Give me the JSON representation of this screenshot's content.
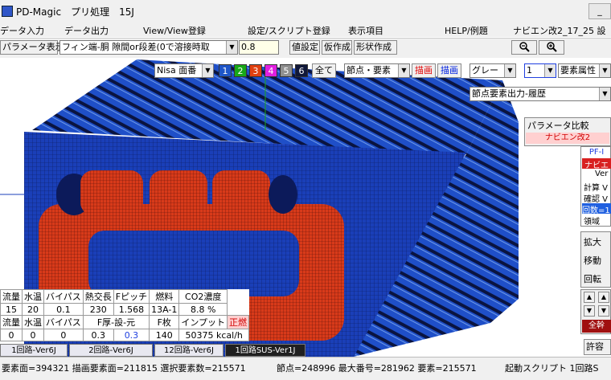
{
  "window": {
    "title": "PD-Magic　プリ処理　15J",
    "minimize_label": "_"
  },
  "menu": [
    {
      "label": "データ入力"
    },
    {
      "label": "データ出力"
    },
    {
      "label": "View/View登録"
    },
    {
      "label": "設定/スクリプト登録"
    },
    {
      "label": "表示項目"
    },
    {
      "label": "HELP/例題"
    },
    {
      "label": "ナビエン改2_17_25 設"
    }
  ],
  "toolbar": {
    "param_button": "パラメータ表示",
    "param_select": "フィン端-胴 隙間or段差(0で溶接時取",
    "param_value": "0.8",
    "set_value": "値設定",
    "temp_create": "仮作成",
    "shape_create": "形状作成",
    "zoom_out_icon": "zoom-out-icon",
    "zoom_in_icon": "zoom-in-icon"
  },
  "viewbar": {
    "nisa_select": "Nisa 面番",
    "layers": [
      {
        "label": "1",
        "color": "#1f56c8"
      },
      {
        "label": "2",
        "color": "#18a818"
      },
      {
        "label": "3",
        "color": "#e04010"
      },
      {
        "label": "4",
        "color": "#e020e0"
      },
      {
        "label": "5",
        "color": "#909090"
      },
      {
        "label": "6",
        "color": "#10183a"
      }
    ],
    "all_button": "全て",
    "node_select": "節点・要素",
    "draw_red": "描画",
    "draw_blue": "描画",
    "color_select": "グレー",
    "num_select": "1",
    "attr_select": "要素属性",
    "output_select": "節点要素出力-履歴"
  },
  "side": {
    "param_compare": "パラメータ比較",
    "navien_pink": "ナビエン改2",
    "pf_label": "PF-I",
    "navien2": "ナビエン",
    "ver": "Ver",
    "calc": "計算 V",
    "check": "確認 V",
    "count": "回数=1",
    "region": "領域",
    "expand": "拡大",
    "move": "移動",
    "rotate": "回転",
    "permit": "許容",
    "zenkan": "全幹"
  },
  "table": {
    "header1": [
      "流量",
      "水温",
      "バイパス",
      "熱交長",
      "Fピッチ",
      "燃料",
      "CO2濃度"
    ],
    "row1": [
      "15",
      "20",
      "0.1",
      "230",
      "1.568",
      "13A-1",
      "8.8 %"
    ],
    "header2": [
      "流量",
      "水温",
      "バイパス",
      "F厚-設-元",
      "",
      "F枚",
      "インプット",
      "正燃"
    ],
    "row2": [
      "0",
      "0",
      "0",
      "0.3",
      "0.3",
      "140",
      "50375 kcal/h"
    ]
  },
  "tabs": [
    {
      "label": "1回路-Ver6J"
    },
    {
      "label": "2回路-Ver6J"
    },
    {
      "label": "12回路-Ver6J"
    },
    {
      "label": "1回路SUS-Ver1J"
    }
  ],
  "status": {
    "faces": "要素面=394321 描画要素面=211815 選択要素数=215571",
    "nodes": "節点=248996 最大番号=281962 要素=215571",
    "script": "起動スクリプト 1回路S"
  },
  "colors": {
    "mesh_blue": "#1a3fb8",
    "mesh_red": "#d83a1a",
    "mesh_dark": "#0c1a5a"
  }
}
